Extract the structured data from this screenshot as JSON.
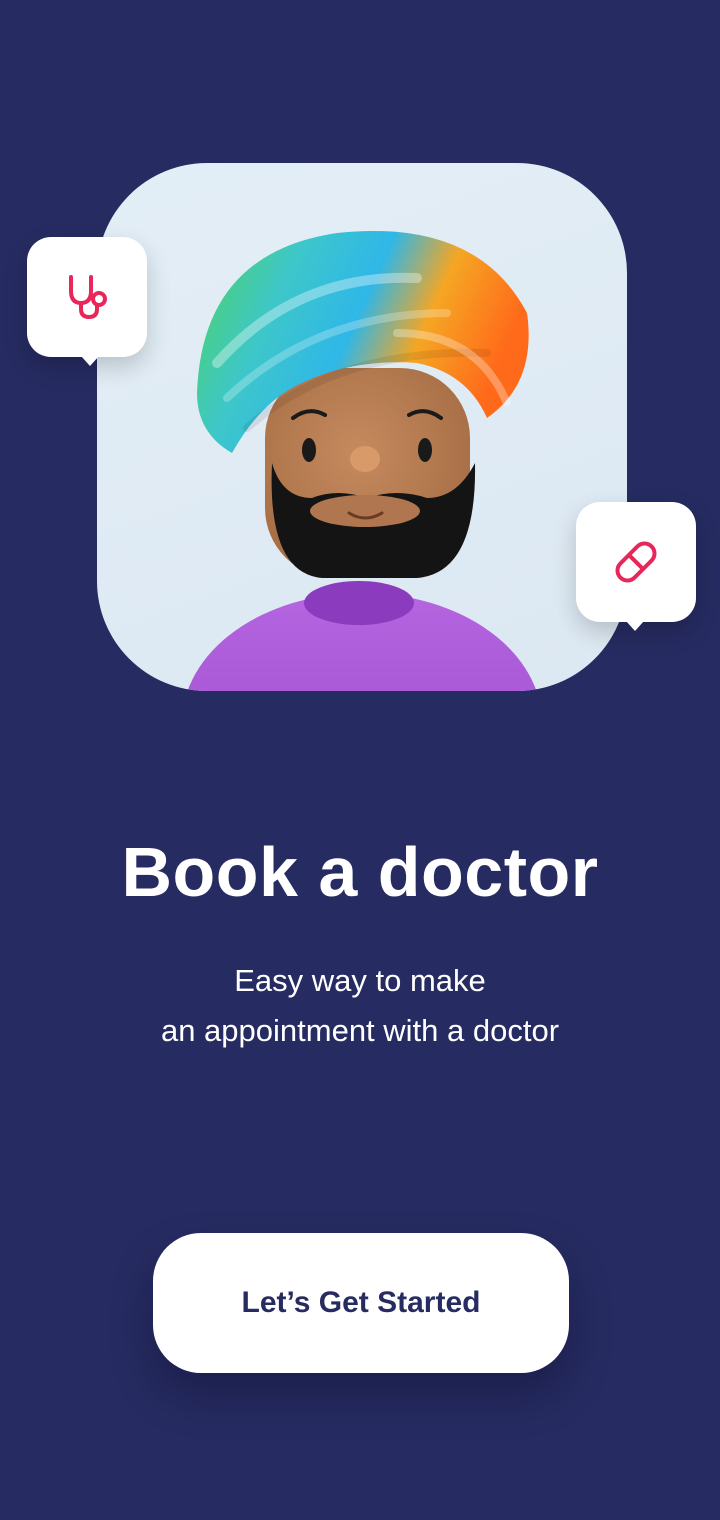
{
  "onboarding": {
    "title": "Book a doctor",
    "subtitle_line1": "Easy way to make",
    "subtitle_line2": "an appointment with a doctor",
    "cta_label": "Let’s Get Started"
  },
  "icons": {
    "top_left": "stethoscope-icon",
    "right": "pill-icon"
  },
  "colors": {
    "background": "#262b61",
    "accent": "#e8265a",
    "button_bg": "#ffffff",
    "button_text": "#262b61"
  }
}
